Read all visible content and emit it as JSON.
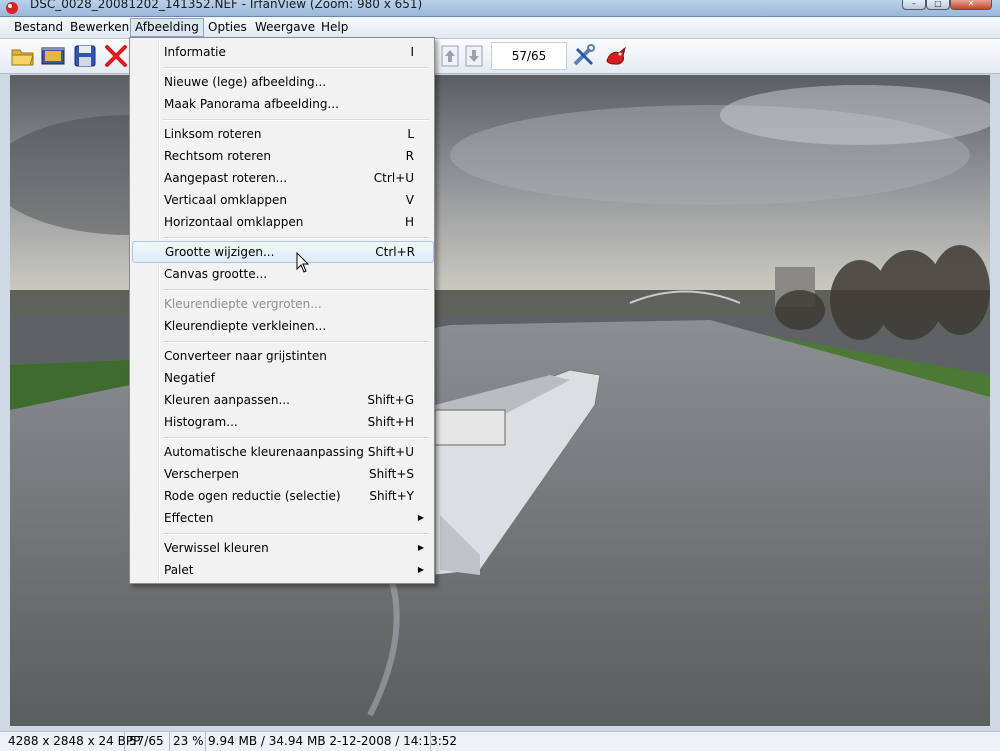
{
  "window": {
    "title": "DSC_0028_20081202_141352.NEF - IrfanView (Zoom: 980 x 651)",
    "controls": {
      "minimize": "–",
      "maximize": "□",
      "close": "✕"
    }
  },
  "menubar": {
    "items": [
      "Bestand",
      "Bewerken",
      "Afbeelding",
      "Opties",
      "Weergave",
      "Help"
    ],
    "active": "Afbeelding"
  },
  "toolbar": {
    "page_counter": "57/65",
    "icons": [
      "open-folder-icon",
      "slideshow-icon",
      "save-icon",
      "delete-icon",
      "up-arrow-icon",
      "down-arrow-icon",
      "settings-tools-icon",
      "irfanview-logo-icon"
    ]
  },
  "dropdown": {
    "items": [
      {
        "label": "Informatie",
        "shortcut": "I"
      },
      {
        "label": "Nieuwe (lege) afbeelding...",
        "shortcut": ""
      },
      {
        "label": "Maak Panorama afbeelding...",
        "shortcut": ""
      },
      {
        "label": "Linksom roteren",
        "shortcut": "L"
      },
      {
        "label": "Rechtsom roteren",
        "shortcut": "R"
      },
      {
        "label": "Aangepast roteren...",
        "shortcut": "Ctrl+U"
      },
      {
        "label": "Verticaal omklappen",
        "shortcut": "V"
      },
      {
        "label": "Horizontaal omklappen",
        "shortcut": "H"
      },
      {
        "label": "Grootte wijzigen...",
        "shortcut": "Ctrl+R",
        "highlighted": true
      },
      {
        "label": "Canvas grootte...",
        "shortcut": ""
      },
      {
        "label": "Kleurendiepte vergroten...",
        "shortcut": "",
        "disabled": true
      },
      {
        "label": "Kleurendiepte verkleinen...",
        "shortcut": ""
      },
      {
        "label": "Converteer naar grijstinten",
        "shortcut": ""
      },
      {
        "label": "Negatief",
        "shortcut": ""
      },
      {
        "label": "Kleuren aanpassen...",
        "shortcut": "Shift+G"
      },
      {
        "label": "Histogram...",
        "shortcut": "Shift+H"
      },
      {
        "label": "Automatische kleurenaanpassing",
        "shortcut": "Shift+U"
      },
      {
        "label": "Verscherpen",
        "shortcut": "Shift+S"
      },
      {
        "label": "Rode ogen reductie (selectie)",
        "shortcut": "Shift+Y"
      },
      {
        "label": "Effecten",
        "shortcut": "",
        "submenu": true
      },
      {
        "label": "Verwissel kleuren",
        "shortcut": "",
        "submenu": true
      },
      {
        "label": "Palet",
        "shortcut": "",
        "submenu": true
      }
    ]
  },
  "statusbar": {
    "dimensions": "4288 x 2848 x 24 BPP",
    "index": "57/65",
    "zoom": "23 %",
    "size_date": "9.94 MB / 34.94 MB 2-12-2008 / 14:13:52"
  },
  "colors": {
    "menu_highlight": "#dfebf8",
    "menu_background": "#f2f2f2",
    "titlebar": "#b9d1ea"
  }
}
